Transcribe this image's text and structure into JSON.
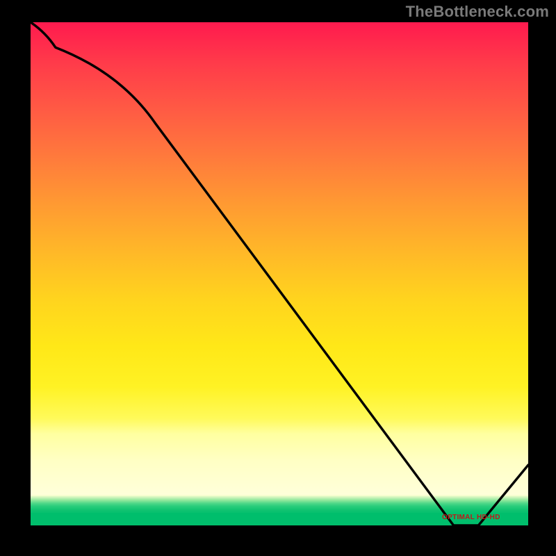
{
  "watermark": "TheBottleneck.com",
  "chart_data": {
    "type": "line",
    "title": "",
    "xlabel": "",
    "ylabel": "",
    "x": [
      0,
      5,
      25,
      85,
      90,
      100
    ],
    "y": [
      100,
      95,
      80,
      0,
      0,
      12
    ],
    "xlim": [
      0,
      100
    ],
    "ylim": [
      0,
      100
    ],
    "optimal_band_x": [
      85,
      90
    ],
    "grid": false,
    "annotations": [
      {
        "text": "OPTIMAL HD-HD",
        "x": 87.5,
        "y": 1
      }
    ],
    "background": {
      "type": "vertical-gradient",
      "stops": [
        {
          "y": 100,
          "color": "#ff1a4e"
        },
        {
          "y": 50,
          "color": "#ffb828"
        },
        {
          "y": 20,
          "color": "#fff224"
        },
        {
          "y": 8,
          "color": "#ffffc4"
        },
        {
          "y": 3,
          "color": "#48d686"
        },
        {
          "y": 0,
          "color": "#00be6c"
        }
      ]
    }
  },
  "optimal_label": "OPTIMAL HD-HD"
}
